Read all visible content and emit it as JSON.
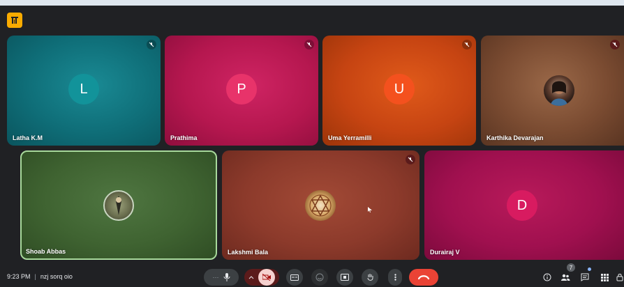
{
  "app": {
    "icon": "meet-app-icon"
  },
  "participants": [
    {
      "name": "Latha K.M",
      "initial": "L",
      "avatar_color": "#12939a",
      "tile_color": "#0f6e78",
      "muted": true
    },
    {
      "name": "Prathima",
      "initial": "P",
      "avatar_color": "#e8336a",
      "tile_color": "#b5174f",
      "muted": true
    },
    {
      "name": "Uma Yerramilli",
      "initial": "U",
      "avatar_color": "#f4511e",
      "tile_color": "#c64412",
      "muted": true
    },
    {
      "name": "Karthika Devarajan",
      "initial": "",
      "avatar_color": "#8a5a3a",
      "tile_color": "#7a4b31",
      "muted": true
    },
    {
      "name": "Shoab Abbas",
      "initial": "",
      "avatar_color": "#4a6a3a",
      "tile_color": "#3f6331",
      "muted": false,
      "speaking": true
    },
    {
      "name": "Lakshmi Bala",
      "initial": "",
      "avatar_color": "#c28a4a",
      "tile_color": "#8c3a2b",
      "muted": true
    },
    {
      "name": "Durairaj V",
      "initial": "D",
      "avatar_color": "#d81b60",
      "tile_color": "#a0104f",
      "muted": false
    }
  ],
  "meeting": {
    "time": "9:23 PM",
    "code": "nzj sorq oio"
  },
  "controls": {
    "people_count": "7"
  },
  "colors": {
    "end_call": "#ea4335",
    "camera_off": "#f6d1cf",
    "speaking_border": "#a8d99c"
  }
}
